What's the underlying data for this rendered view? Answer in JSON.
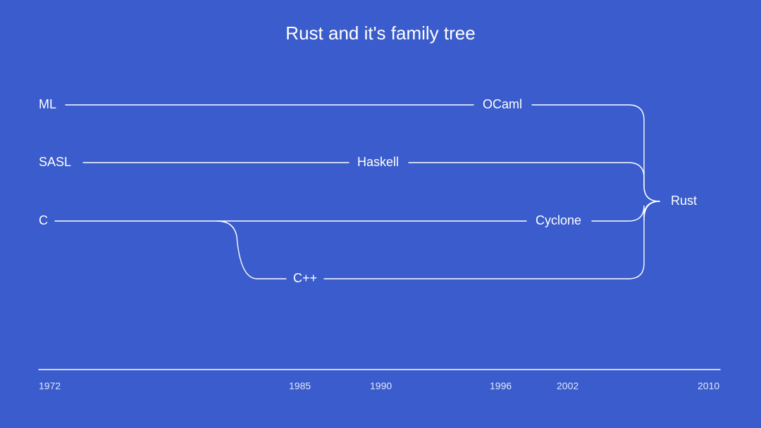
{
  "title": "Rust and it's family tree",
  "languages": {
    "ml": "ML",
    "ocaml": "OCaml",
    "sasl": "SASL",
    "haskell": "Haskell",
    "c": "C",
    "cyclone": "Cyclone",
    "cpp": "C++",
    "rust": "Rust"
  },
  "years": {
    "y1972": "1972",
    "y1985": "1985",
    "y1990": "1990",
    "y1996": "1996",
    "y2002": "2002",
    "y2010": "2010"
  },
  "chart_data": {
    "type": "diagram",
    "title": "Rust and it's family tree",
    "timeline_ticks": [
      1972,
      1985,
      1990,
      1996,
      2002,
      2010
    ],
    "nodes": [
      {
        "id": "ml",
        "label": "ML",
        "approx_year": 1972
      },
      {
        "id": "ocaml",
        "label": "OCaml",
        "approx_year": 1996
      },
      {
        "id": "sasl",
        "label": "SASL",
        "approx_year": 1972
      },
      {
        "id": "haskell",
        "label": "Haskell",
        "approx_year": 1990
      },
      {
        "id": "c",
        "label": "C",
        "approx_year": 1972
      },
      {
        "id": "cyclone",
        "label": "Cyclone",
        "approx_year": 2002
      },
      {
        "id": "cpp",
        "label": "C++",
        "approx_year": 1985
      },
      {
        "id": "rust",
        "label": "Rust",
        "approx_year": 2010
      }
    ],
    "edges": [
      {
        "from": "ml",
        "to": "ocaml"
      },
      {
        "from": "ocaml",
        "to": "rust"
      },
      {
        "from": "sasl",
        "to": "haskell"
      },
      {
        "from": "haskell",
        "to": "rust"
      },
      {
        "from": "c",
        "to": "cyclone"
      },
      {
        "from": "cyclone",
        "to": "rust"
      },
      {
        "from": "c",
        "to": "cpp"
      },
      {
        "from": "cpp",
        "to": "rust"
      }
    ]
  }
}
